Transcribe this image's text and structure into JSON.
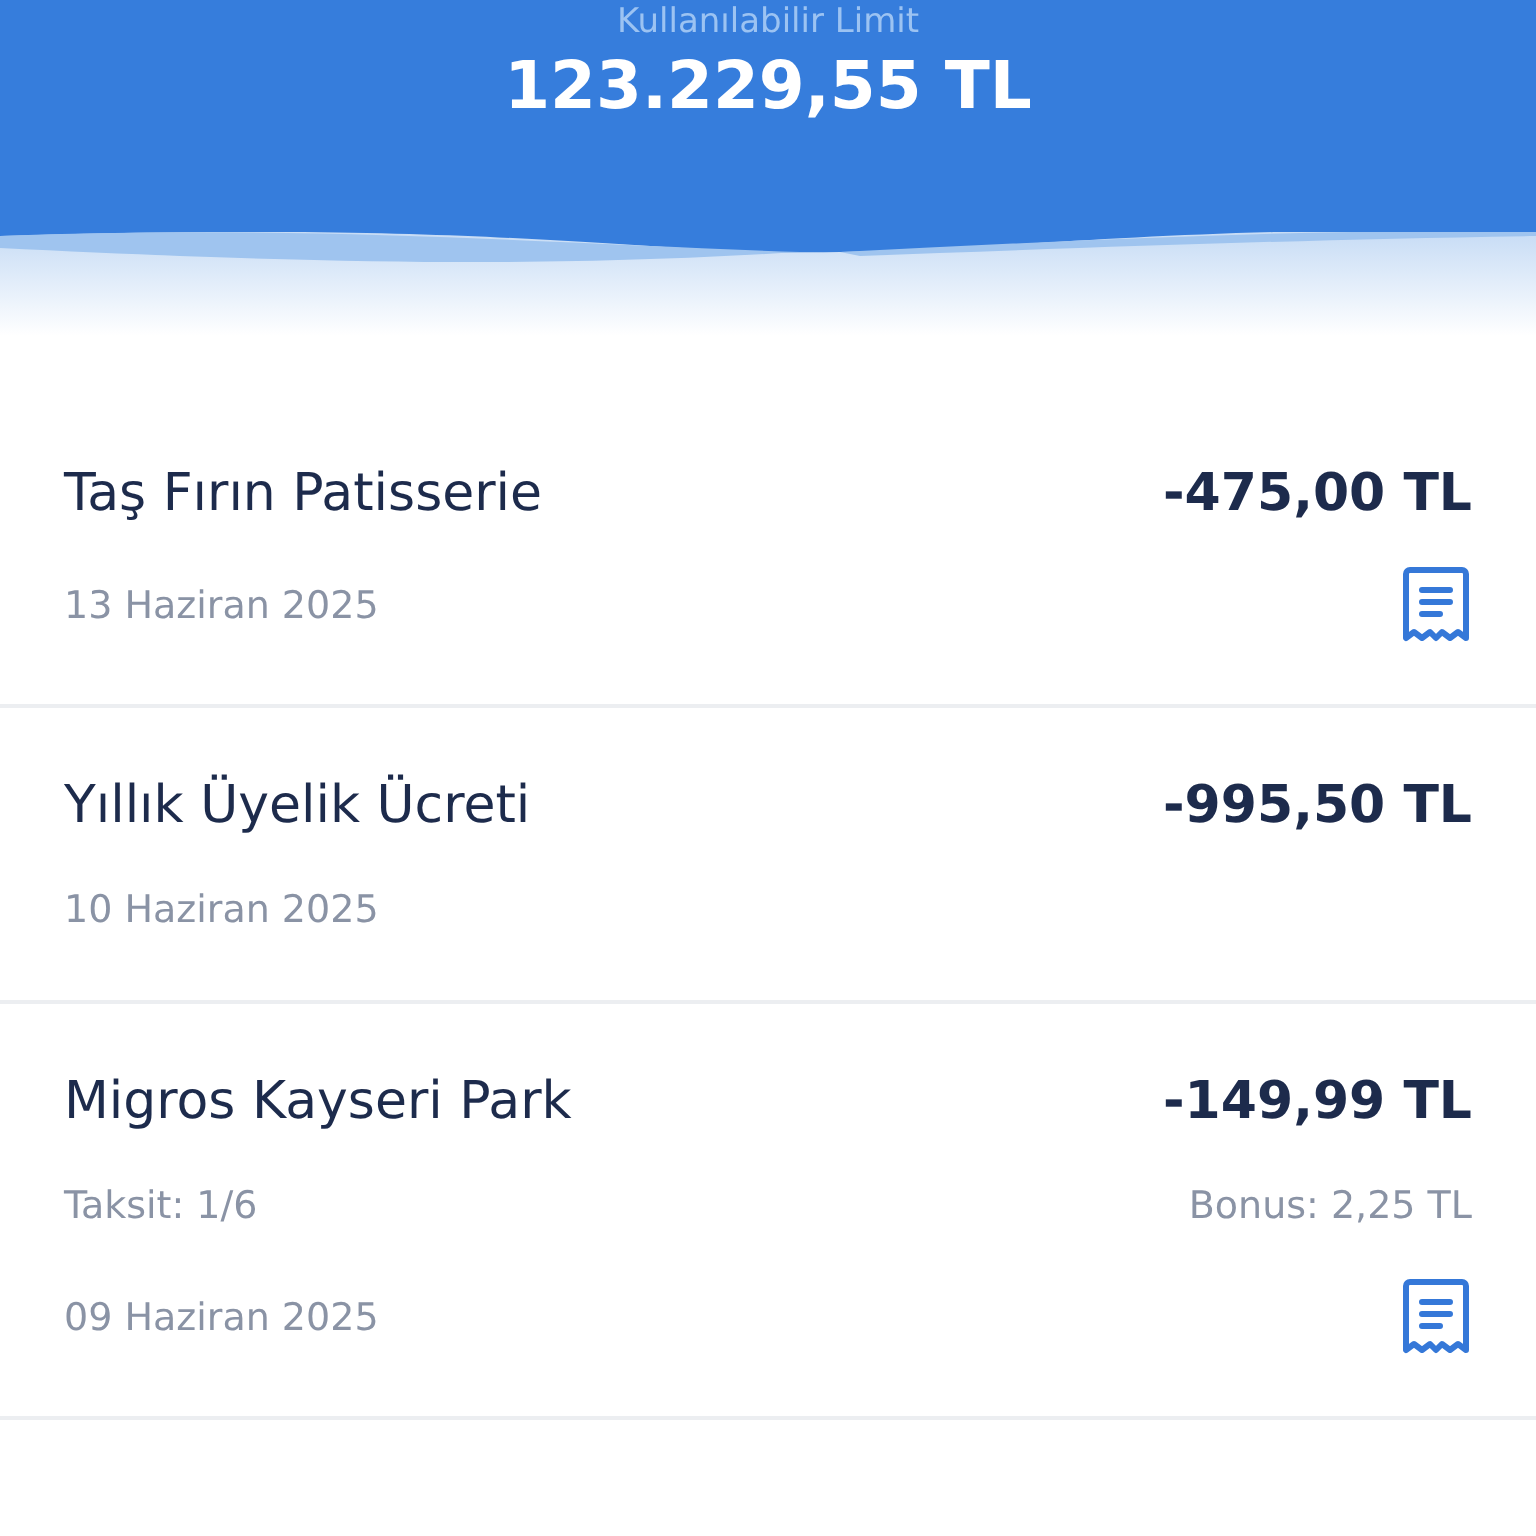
{
  "header": {
    "label": "Kullanılabilir Limit",
    "amount": "123.229,55 TL"
  },
  "transactions": [
    {
      "name": "Taş Fırın Patisserie",
      "amount": "-475,00 TL",
      "date": "13 Haziran 2025",
      "receipt": true
    },
    {
      "name": "Yıllık Üyelik Ücreti",
      "amount": "-995,50 TL",
      "date": "10 Haziran 2025",
      "receipt": false
    },
    {
      "name": "Migros Kayseri Park",
      "amount": "-149,99 TL",
      "installment": "Taksit: 1/6",
      "bonus": "Bonus: 2,25 TL",
      "date": "09 Haziran 2025",
      "receipt": true
    }
  ]
}
